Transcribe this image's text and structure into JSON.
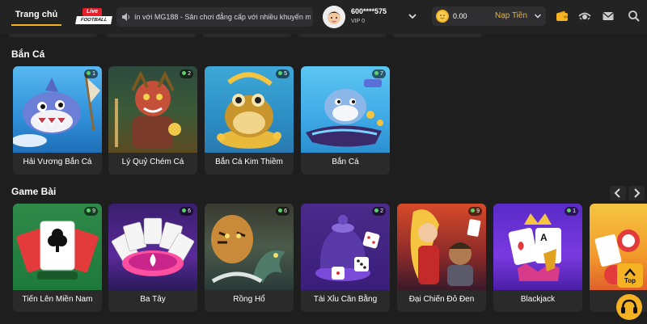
{
  "header": {
    "home_tab": "Trang chủ",
    "live_logo_top": "Live",
    "live_logo_bottom": "FOOTBALL",
    "marquee_text": "ín với MG188 - Sân chơi đẳng cấp với nhiều khuyến m",
    "user_id": "600****575",
    "vip_level": "VIP 0",
    "balance": "0.00",
    "deposit_label": "Nạp Tiền",
    "icons": [
      "speaker-icon",
      "chevron-down-icon",
      "coin-icon",
      "wallet-icon",
      "eye-icon",
      "mail-icon",
      "search-icon"
    ]
  },
  "sections": [
    {
      "title": "Bắn Cá",
      "games": [
        {
          "name": "Hải Vương Bắn Cá",
          "players": "1"
        },
        {
          "name": "Lý Quỷ Chém Cá",
          "players": "2"
        },
        {
          "name": "Bắn Cá Kim Thiềm",
          "players": "5"
        },
        {
          "name": "Bắn Cá",
          "players": "7"
        }
      ]
    },
    {
      "title": "Game Bài",
      "games": [
        {
          "name": "Tiến Lên Miền Nam",
          "players": "9"
        },
        {
          "name": "Ba Tây",
          "players": "6"
        },
        {
          "name": "Rồng Hổ",
          "players": "6"
        },
        {
          "name": "Tài Xỉu Cân Bằng",
          "players": "2"
        },
        {
          "name": "Đại Chiến Đỏ Đen",
          "players": "9"
        },
        {
          "name": "Blackjack",
          "players": "1"
        }
      ]
    }
  ],
  "floating": {
    "top_label": "Top"
  },
  "colors": {
    "accent": "#f5b324",
    "background": "#1e1e1f",
    "card": "#2a2a2b",
    "online_dot": "#5bd16a"
  }
}
